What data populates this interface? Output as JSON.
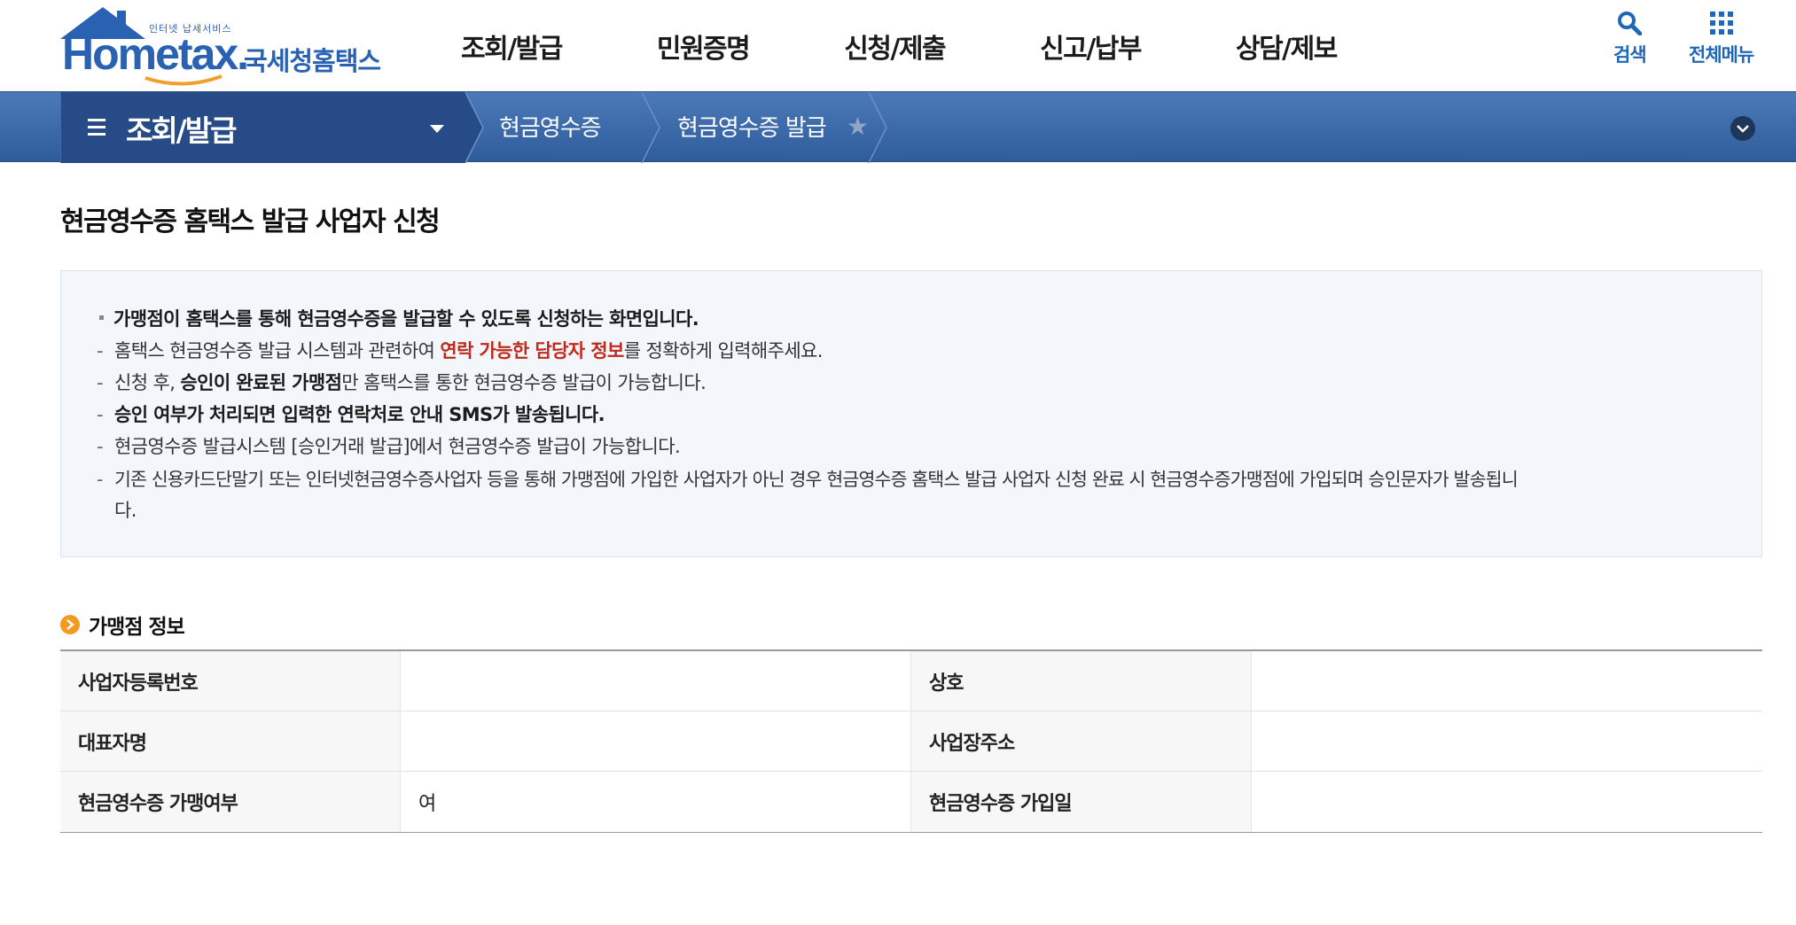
{
  "header": {
    "logo": {
      "small_text": "인터넷 납세서비스",
      "brand": "Hometax.",
      "korean_name": "국세청홈택스"
    },
    "nav": [
      "조회/발급",
      "민원증명",
      "신청/제출",
      "신고/납부",
      "상담/제보"
    ],
    "utility": {
      "search_label": "검색",
      "menu_label": "전체메뉴"
    }
  },
  "location": {
    "main_menu": "조회/발급",
    "crumbs": [
      "현금영수증",
      "현금영수증 발급"
    ]
  },
  "page": {
    "title": "현금영수증 홈택스 발급 사업자 신청"
  },
  "notice": {
    "line1": "가맹점이 홈택스를 통해 현금영수증을 발급할 수 있도록 신청하는 화면입니다.",
    "line2_pre": "홈택스 현금영수증 발급 시스템과 관련하여 ",
    "line2_highlight": "연락 가능한 담당자 정보",
    "line2_post": "를 정확하게 입력해주세요.",
    "line3_pre": "신청 후, ",
    "line3_bold": "승인이 완료된 가맹점",
    "line3_post": "만 홈택스를 통한 현금영수증 발급이 가능합니다.",
    "line4": "승인 여부가 처리되면 입력한 연락처로 안내 SMS가 발송됩니다.",
    "line5": "현금영수증 발급시스템 [승인거래 발급]에서 현금영수증 발급이 가능합니다.",
    "line6a": "기존 신용카드단말기 또는 인터넷현금영수증사업자 등을 통해 가맹점에 가입한 사업자가 아닌 경우 현금영수증 홈택스 발급 사업자 신청 완료 시 현금영수증가맹점에 가입되며 승인문자가 발송됩니",
    "line6b": "다."
  },
  "merchant": {
    "section_title": "가맹점 정보",
    "rows": [
      {
        "label1": "사업자등록번호",
        "value1": "",
        "label2": "상호",
        "value2": ""
      },
      {
        "label1": "대표자명",
        "value1": "",
        "label2": "사업장주소",
        "value2": ""
      },
      {
        "label1": "현금영수증 가맹여부",
        "value1": "여",
        "label2": "현금영수증 가입일",
        "value2": ""
      }
    ]
  },
  "colors": {
    "brand_blue": "#2a62b3",
    "location_bar": "#3a67a8",
    "highlight_red": "#c12a1b",
    "section_bullet": "#f29b1e"
  }
}
